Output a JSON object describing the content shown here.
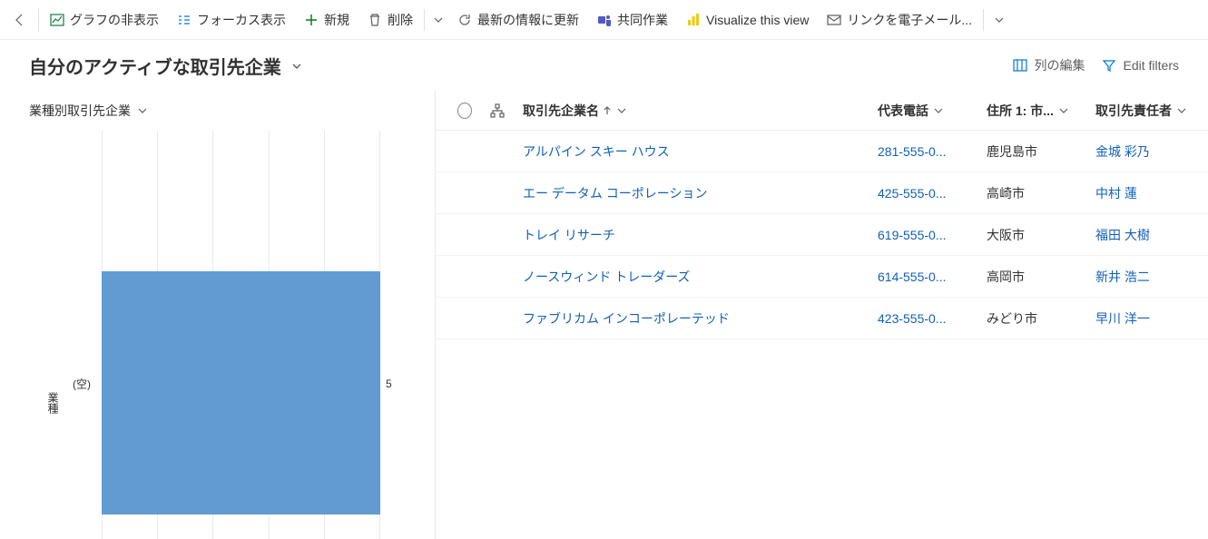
{
  "toolbar": {
    "hide_chart": "グラフの非表示",
    "focus_view": "フォーカス表示",
    "new": "新規",
    "delete": "削除",
    "refresh": "最新の情報に更新",
    "collaborate": "共同作業",
    "visualize": "Visualize this view",
    "email_link": "リンクを電子メール..."
  },
  "view": {
    "title": "自分のアクティブな取引先企業",
    "edit_columns": "列の編集",
    "edit_filters": "Edit filters"
  },
  "chart": {
    "title": "業種別取引先企業",
    "axis_label": "業種",
    "category_label": "(空)",
    "value_label": "5"
  },
  "grid": {
    "columns": {
      "name": "取引先企業名",
      "phone": "代表電話",
      "city": "住所 1: 市...",
      "owner": "取引先責任者"
    },
    "rows": [
      {
        "name": "アルパイン スキー ハウス",
        "phone": "281-555-0...",
        "city": "鹿児島市",
        "owner": "金城 彩乃"
      },
      {
        "name": "エー データム コーポレーション",
        "phone": "425-555-0...",
        "city": "高崎市",
        "owner": "中村 蓮"
      },
      {
        "name": "トレイ リサーチ",
        "phone": "619-555-0...",
        "city": "大阪市",
        "owner": "福田 大樹"
      },
      {
        "name": "ノースウィンド トレーダーズ",
        "phone": "614-555-0...",
        "city": "高岡市",
        "owner": "新井 浩二"
      },
      {
        "name": "ファブリカム インコーポレーテッド",
        "phone": "423-555-0...",
        "city": "みどり市",
        "owner": "早川 洋一"
      }
    ]
  },
  "chart_data": {
    "type": "bar",
    "orientation": "horizontal",
    "categories": [
      "(空)"
    ],
    "values": [
      5
    ],
    "title": "業種別取引先企業",
    "xlabel": "",
    "ylabel": "業種",
    "xlim": [
      0,
      5
    ]
  }
}
